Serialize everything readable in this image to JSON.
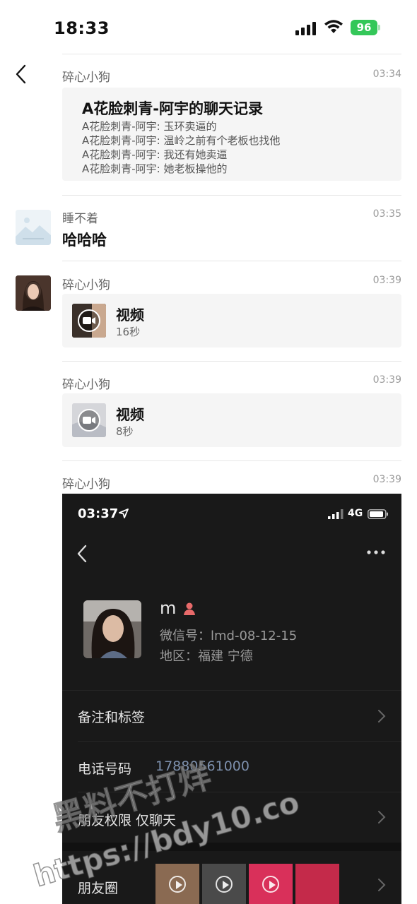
{
  "status_bar": {
    "time": "18:33",
    "battery": "96"
  },
  "nav": {
    "back_icon": "chevron-left-icon"
  },
  "messages": [
    {
      "sender": "碎心小狗",
      "time": "03:34",
      "type": "chat-record",
      "record_title": "A花脸刺青-阿宇的聊天记录",
      "record_lines": [
        "A花脸刺青-阿宇: 玉环卖逼的",
        "A花脸刺青-阿宇: 温岭之前有个老板也找他",
        "A花脸刺青-阿宇: 我还有她卖逼",
        "A花脸刺青-阿宇: 她老板操他的"
      ]
    },
    {
      "sender": "睡不着",
      "time": "03:35",
      "type": "text",
      "text": "哈哈哈"
    },
    {
      "sender": "碎心小狗",
      "time": "03:39",
      "type": "video",
      "label": "视频",
      "duration": "16秒"
    },
    {
      "sender": "碎心小狗",
      "time": "03:39",
      "type": "video",
      "label": "视频",
      "duration": "8秒"
    },
    {
      "sender": "碎心小狗",
      "time": "03:39",
      "type": "image"
    }
  ],
  "embedded_profile": {
    "time": "03:37",
    "network": "4G",
    "name": "m",
    "wechat_id": "微信号：lmd-08-12-15",
    "region": "地区：福建 宁德",
    "rows": {
      "remark_tags": "备注和标签",
      "phone_label": "电话号码",
      "phone_value": "17880561000",
      "friend_perm_label": "朋友权限",
      "friend_perm_value": "仅聊天",
      "moments_label": "朋友圈"
    }
  },
  "watermark": {
    "line1": "黑料不打烊",
    "line2": "https://bdy10.co"
  }
}
